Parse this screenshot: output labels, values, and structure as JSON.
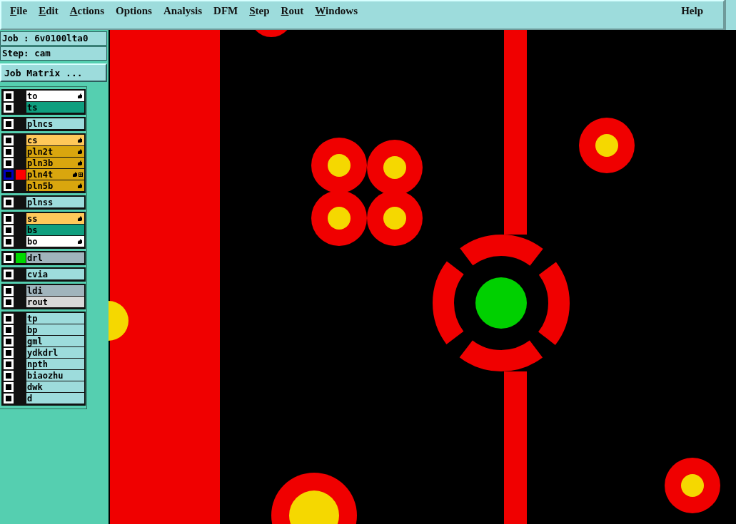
{
  "menu": [
    {
      "label": "File",
      "mnemonic": true
    },
    {
      "label": "Edit",
      "mnemonic": true
    },
    {
      "label": "Actions",
      "mnemonic": true
    },
    {
      "label": "Options",
      "mnemonic": false
    },
    {
      "label": "Analysis",
      "mnemonic": false
    },
    {
      "label": "DFM",
      "mnemonic": false
    },
    {
      "label": "Step",
      "mnemonic": true
    },
    {
      "label": "Rout",
      "mnemonic": true
    },
    {
      "label": "Windows",
      "mnemonic": true
    }
  ],
  "help": "Help",
  "job": "Job : 6v0100lta0",
  "step": "Step: cam",
  "job_matrix_button": "Job Matrix ...",
  "layer_groups": [
    {
      "layers": [
        {
          "name": "to",
          "kind": "silk",
          "affected": true,
          "selected": false
        },
        {
          "name": "ts",
          "kind": "mask",
          "affected": false,
          "selected": false
        }
      ]
    },
    {
      "layers": [
        {
          "name": "plncs",
          "kind": "document",
          "affected": false,
          "selected": false
        }
      ]
    },
    {
      "layers": [
        {
          "name": "cs",
          "kind": "outer",
          "affected": true,
          "selected": false
        },
        {
          "name": "pln2t",
          "kind": "inner",
          "affected": true,
          "selected": false
        },
        {
          "name": "pln3b",
          "kind": "inner",
          "affected": true,
          "selected": false
        },
        {
          "name": "pln4t",
          "kind": "inner",
          "affected": true,
          "selected": true,
          "color": "#ff0000"
        },
        {
          "name": "pln5b",
          "kind": "inner",
          "affected": true,
          "selected": false
        }
      ]
    },
    {
      "layers": [
        {
          "name": "plnss",
          "kind": "document",
          "affected": false,
          "selected": false
        }
      ]
    },
    {
      "layers": [
        {
          "name": "ss",
          "kind": "outer",
          "affected": true,
          "selected": false
        },
        {
          "name": "bs",
          "kind": "mask",
          "affected": false,
          "selected": false
        },
        {
          "name": "bo",
          "kind": "silk",
          "affected": true,
          "selected": false
        }
      ]
    },
    {
      "layers": [
        {
          "name": "drl",
          "kind": "drill",
          "affected": false,
          "selected": false,
          "color": "#00d800"
        }
      ]
    },
    {
      "layers": [
        {
          "name": "cvia",
          "kind": "document",
          "affected": false,
          "selected": false
        }
      ]
    },
    {
      "layers": [
        {
          "name": "ldi",
          "kind": "drill",
          "affected": false,
          "selected": false
        },
        {
          "name": "rout",
          "kind": "rout",
          "affected": false,
          "selected": false
        }
      ]
    },
    {
      "layers": [
        {
          "name": "tp",
          "kind": "document",
          "affected": false,
          "selected": false
        },
        {
          "name": "bp",
          "kind": "document",
          "affected": false,
          "selected": false
        },
        {
          "name": "gml",
          "kind": "document",
          "affected": false,
          "selected": false
        },
        {
          "name": "ydkdrl",
          "kind": "document",
          "affected": false,
          "selected": false
        },
        {
          "name": "npth",
          "kind": "document",
          "affected": false,
          "selected": false
        },
        {
          "name": "biaozhu",
          "kind": "document",
          "affected": false,
          "selected": false
        },
        {
          "name": "dwk",
          "kind": "document",
          "affected": false,
          "selected": false
        },
        {
          "name": "d",
          "kind": "document",
          "affected": false,
          "selected": false
        }
      ]
    }
  ]
}
